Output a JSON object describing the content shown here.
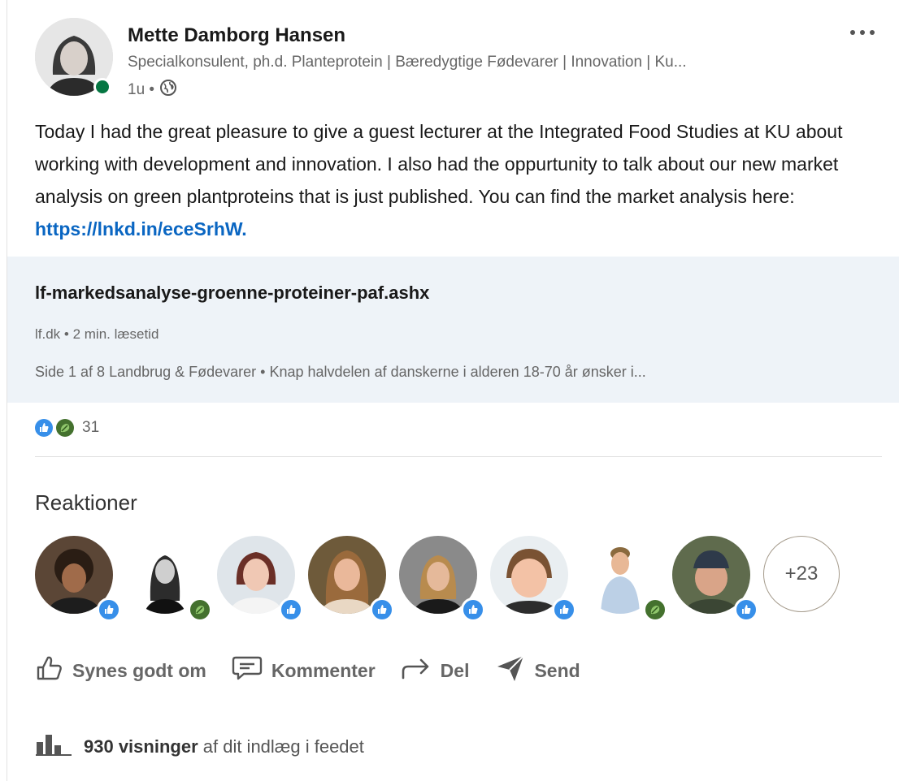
{
  "author": {
    "name": "Mette Damborg Hansen",
    "headline": "Specialkonsulent, ph.d. Planteprotein | Bæredygtige Fødevarer | Innovation | Ku...",
    "time": "1u •",
    "online_status_color": "#057642"
  },
  "post": {
    "text": "Today I had the great pleasure to give a guest lecturer at the Integrated Food Studies at KU about working with development and innovation. I also had the oppurtunity to talk about our new market analysis on green plantproteins that is just published. You can find the market analysis here: ",
    "link_text": "https://lnkd.in/eceSrhW."
  },
  "link_preview": {
    "title": "lf-markedsanalyse-groenne-proteiner-paf.ashx",
    "source": "lf.dk • 2 min. læsetid",
    "snippet": "Side 1 af 8 Landbrug & Fødevarer • Knap halvdelen af danskerne i alderen 18-70 år ønsker i..."
  },
  "reactions": {
    "count": "31",
    "types": [
      "like-icon",
      "support-icon"
    ],
    "heading": "Reaktioner",
    "more_count": "+23",
    "reactors": [
      {
        "reaction": "like"
      },
      {
        "reaction": "support"
      },
      {
        "reaction": "like"
      },
      {
        "reaction": "like"
      },
      {
        "reaction": "like"
      },
      {
        "reaction": "like"
      },
      {
        "reaction": "support"
      },
      {
        "reaction": "like"
      }
    ]
  },
  "actions": {
    "like_label": "Synes godt om",
    "comment_label": "Kommenter",
    "share_label": "Del",
    "send_label": "Send"
  },
  "views": {
    "count_label": "930 visninger",
    "suffix": " af dit indlæg i feedet"
  },
  "colors": {
    "link": "#0a66c2",
    "like_blue": "#378fe9",
    "support_green": "#44712e",
    "preview_bg": "#eef3f8"
  }
}
